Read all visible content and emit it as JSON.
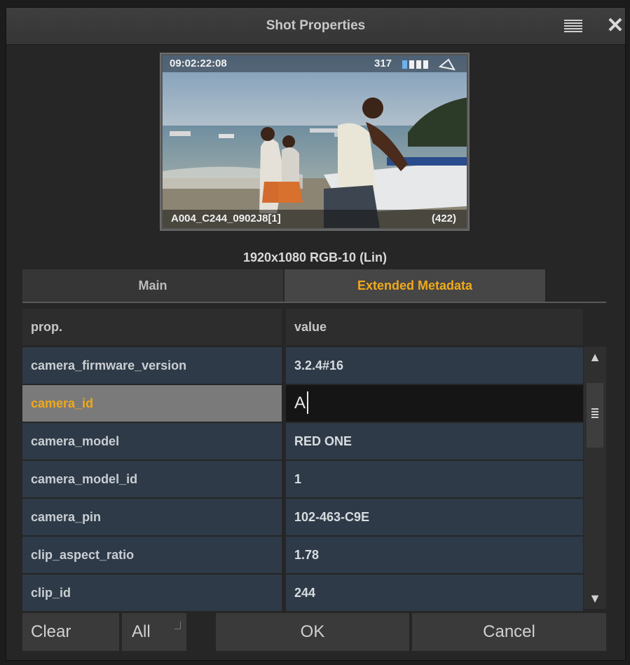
{
  "window": {
    "title": "Shot Properties",
    "menu_icon": "menu-lines-icon",
    "close_icon": "close-icon"
  },
  "thumbnail": {
    "timecode": "09:02:22:08",
    "frame_count": "317",
    "clip_name": "A004_C244_0902J8[1]",
    "clip_number": "(422)"
  },
  "resolution": "1920x1080 RGB-10 (Lin)",
  "tabs": [
    {
      "label": "Main",
      "active": false
    },
    {
      "label": "Extended Metadata",
      "active": true
    }
  ],
  "table": {
    "headers": {
      "prop": "prop.",
      "value": "value"
    },
    "rows": [
      {
        "prop": "camera_firmware_version",
        "value": "3.2.4#16"
      },
      {
        "prop": "camera_id",
        "value": "A",
        "selected": true,
        "editing": true
      },
      {
        "prop": "camera_model",
        "value": "RED ONE"
      },
      {
        "prop": "camera_model_id",
        "value": "1"
      },
      {
        "prop": "camera_pin",
        "value": "102-463-C9E"
      },
      {
        "prop": "clip_aspect_ratio",
        "value": "1.78"
      },
      {
        "prop": "clip_id",
        "value": "244"
      }
    ]
  },
  "footer": {
    "clear": "Clear",
    "all": "All",
    "ok": "OK",
    "cancel": "Cancel"
  },
  "colors": {
    "accent": "#f0a91a",
    "row_bg": "#2e3a47",
    "selected_prop_bg": "#7a7a7a"
  }
}
